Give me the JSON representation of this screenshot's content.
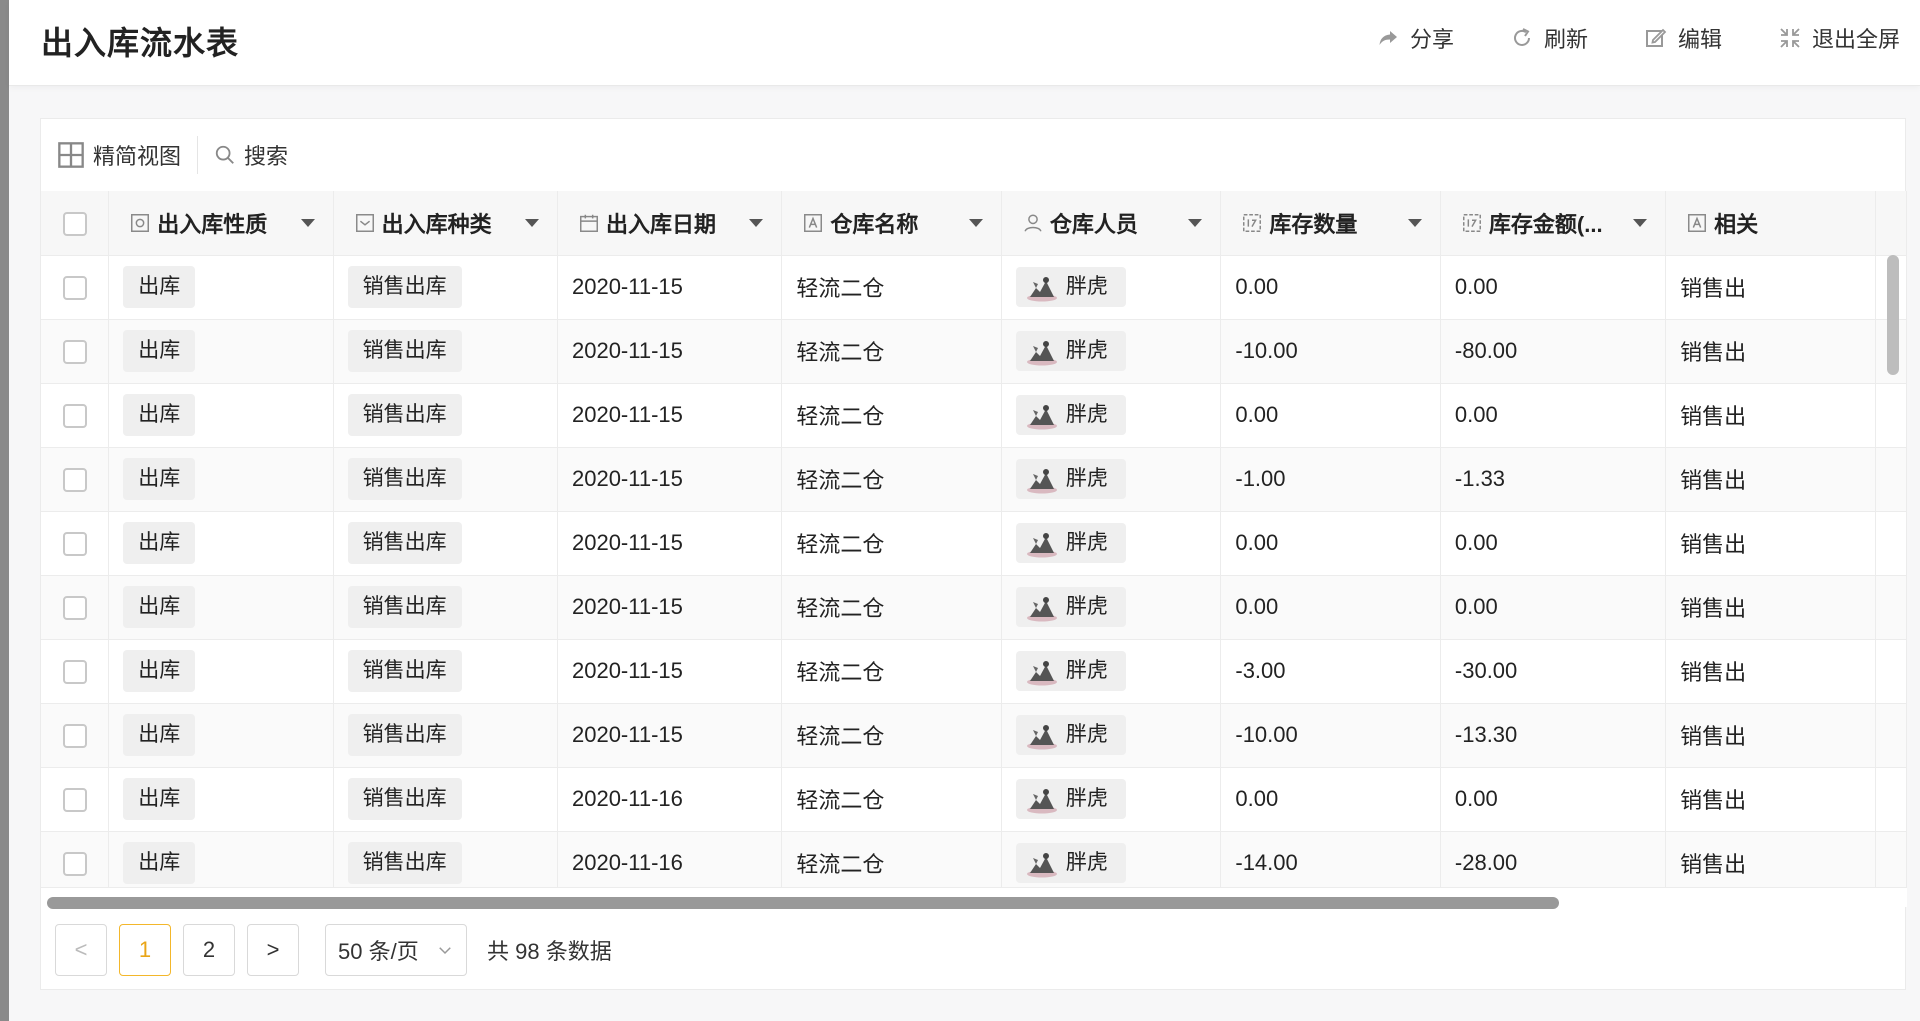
{
  "header": {
    "title": "出入库流水表",
    "actions": {
      "share": "分享",
      "refresh": "刷新",
      "edit": "编辑",
      "exit_fullscreen": "退出全屏"
    }
  },
  "toolbar": {
    "view_label": "精简视图",
    "search_label": "搜索"
  },
  "table": {
    "columns": [
      "出入库性质",
      "出入库种类",
      "出入库日期",
      "仓库名称",
      "仓库人员",
      "库存数量",
      "库存金额(...",
      "相关"
    ],
    "rows": [
      {
        "nature": "出库",
        "kind": "销售出库",
        "date": "2020-11-15",
        "warehouse": "轻流二仓",
        "person": "胖虎",
        "qty": "0.00",
        "amount": "0.00",
        "related": "销售出"
      },
      {
        "nature": "出库",
        "kind": "销售出库",
        "date": "2020-11-15",
        "warehouse": "轻流二仓",
        "person": "胖虎",
        "qty": "-10.00",
        "amount": "-80.00",
        "related": "销售出"
      },
      {
        "nature": "出库",
        "kind": "销售出库",
        "date": "2020-11-15",
        "warehouse": "轻流二仓",
        "person": "胖虎",
        "qty": "0.00",
        "amount": "0.00",
        "related": "销售出"
      },
      {
        "nature": "出库",
        "kind": "销售出库",
        "date": "2020-11-15",
        "warehouse": "轻流二仓",
        "person": "胖虎",
        "qty": "-1.00",
        "amount": "-1.33",
        "related": "销售出"
      },
      {
        "nature": "出库",
        "kind": "销售出库",
        "date": "2020-11-15",
        "warehouse": "轻流二仓",
        "person": "胖虎",
        "qty": "0.00",
        "amount": "0.00",
        "related": "销售出"
      },
      {
        "nature": "出库",
        "kind": "销售出库",
        "date": "2020-11-15",
        "warehouse": "轻流二仓",
        "person": "胖虎",
        "qty": "0.00",
        "amount": "0.00",
        "related": "销售出"
      },
      {
        "nature": "出库",
        "kind": "销售出库",
        "date": "2020-11-15",
        "warehouse": "轻流二仓",
        "person": "胖虎",
        "qty": "-3.00",
        "amount": "-30.00",
        "related": "销售出"
      },
      {
        "nature": "出库",
        "kind": "销售出库",
        "date": "2020-11-15",
        "warehouse": "轻流二仓",
        "person": "胖虎",
        "qty": "-10.00",
        "amount": "-13.30",
        "related": "销售出"
      },
      {
        "nature": "出库",
        "kind": "销售出库",
        "date": "2020-11-16",
        "warehouse": "轻流二仓",
        "person": "胖虎",
        "qty": "0.00",
        "amount": "0.00",
        "related": "销售出"
      },
      {
        "nature": "出库",
        "kind": "销售出库",
        "date": "2020-11-16",
        "warehouse": "轻流二仓",
        "person": "胖虎",
        "qty": "-14.00",
        "amount": "-28.00",
        "related": "销售出"
      }
    ]
  },
  "pagination": {
    "prev": "<",
    "pages": [
      "1",
      "2"
    ],
    "current_page": "1",
    "next": ">",
    "page_size": "50 条/页",
    "total": "共 98 条数据"
  },
  "colors": {
    "accent": "#f3b72b",
    "tag_bg": "#efefef",
    "header_bg": "#f7f7f7"
  },
  "icons": {
    "share": "share-arrow-icon",
    "refresh": "refresh-icon",
    "edit": "edit-icon",
    "exit_fullscreen": "exit-fullscreen-icon",
    "view": "grid-view-icon",
    "search": "search-icon"
  }
}
